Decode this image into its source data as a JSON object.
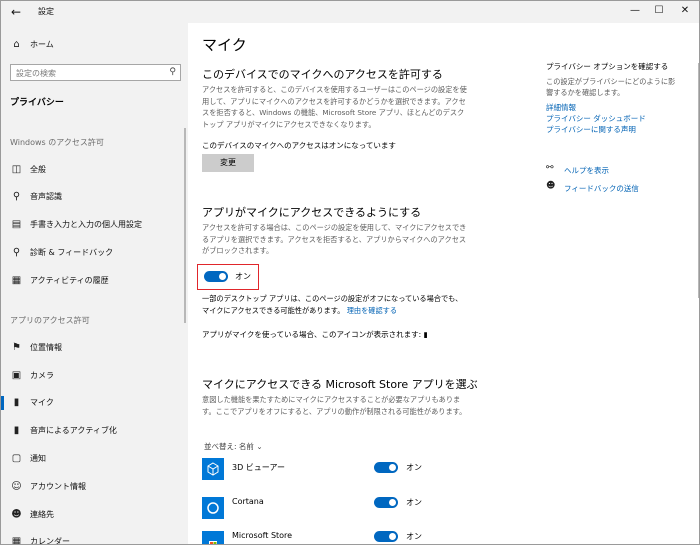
{
  "window": {
    "title": "設定",
    "back_icon": "back-arrow-icon"
  },
  "sidebar": {
    "home_label": "ホーム",
    "search_placeholder": "設定の検索",
    "privacy_heading": "プライバシー",
    "windows_section": "Windows のアクセス許可",
    "windows_items": [
      {
        "label": "全般",
        "icon": "lock-icon"
      },
      {
        "label": "音声認識",
        "icon": "speech-icon"
      },
      {
        "label": "手書き入力と入力の個人用設定",
        "icon": "note-icon"
      },
      {
        "label": "診断 & フィードバック",
        "icon": "diagnostics-icon"
      },
      {
        "label": "アクティビティの履歴",
        "icon": "history-icon"
      }
    ],
    "app_section": "アプリのアクセス許可",
    "app_items": [
      {
        "label": "位置情報",
        "icon": "location-icon"
      },
      {
        "label": "カメラ",
        "icon": "camera-icon"
      },
      {
        "label": "マイク",
        "icon": "microphone-icon"
      },
      {
        "label": "音声によるアクティブ化",
        "icon": "voice-activation-icon"
      },
      {
        "label": "通知",
        "icon": "notification-icon"
      },
      {
        "label": "アカウント情報",
        "icon": "account-icon"
      },
      {
        "label": "連絡先",
        "icon": "contacts-icon"
      },
      {
        "label": "カレンダー",
        "icon": "calendar-icon"
      }
    ]
  },
  "main": {
    "title": "マイク",
    "device_heading": "このデバイスでのマイクへのアクセスを許可する",
    "device_desc": "アクセスを許可すると、このデバイスを使用するユーザーはこのページの設定を使用して、アプリにマイクへのアクセスを許可するかどうかを選択できます。アクセスを拒否すると、Windows の機能、Microsoft Store アプリ、ほとんどのデスクトップ アプリがマイクにアクセスできなくなります。",
    "device_status": "このデバイスのマイクへのアクセスはオンになっています",
    "change_button": "変更",
    "apps_heading": "アプリがマイクにアクセスできるようにする",
    "apps_desc": "アクセスを許可する場合は、このページの設定を使用して、マイクにアクセスできるアプリを選択できます。アクセスを拒否すると、アプリからマイクへのアクセスがブロックされます。",
    "toggle_label": "オン",
    "desktop_note": "一部のデスクトップ アプリは、このページの設定がオフになっている場合でも、マイクにアクセスできる可能性があります。",
    "learn_link": "理由を確認する",
    "icon_note": "アプリがマイクを使っている場合、このアイコンが表示されます:",
    "store_heading": "マイクにアクセスできる Microsoft Store アプリを選ぶ",
    "store_desc": "意図した機能を果たすためにマイクにアクセスすることが必要なアプリもあります。ここでアプリをオフにすると、アプリの動作が制限される可能性があります。",
    "sort_label": "並べ替え: 名前",
    "apps": [
      {
        "name": "3D ビューアー",
        "state": "オン",
        "icon": "cube-icon"
      },
      {
        "name": "Cortana",
        "state": "オン",
        "icon": "cortana-icon"
      },
      {
        "name": "Microsoft Store",
        "state": "オン",
        "icon": "store-icon"
      }
    ]
  },
  "right": {
    "heading": "プライバシー オプションを確認する",
    "desc": "この設定がプライバシーにどのように影響するかを確認します。",
    "links": [
      "詳細情報",
      "プライバシー ダッシュボード",
      "プライバシーに関する声明"
    ],
    "help_label": "ヘルプを表示",
    "feedback_label": "フィードバックの送信"
  },
  "colors": {
    "accent": "#0067c0",
    "highlight": "#e0262b",
    "sidebar_bg": "#f2f2f2"
  }
}
